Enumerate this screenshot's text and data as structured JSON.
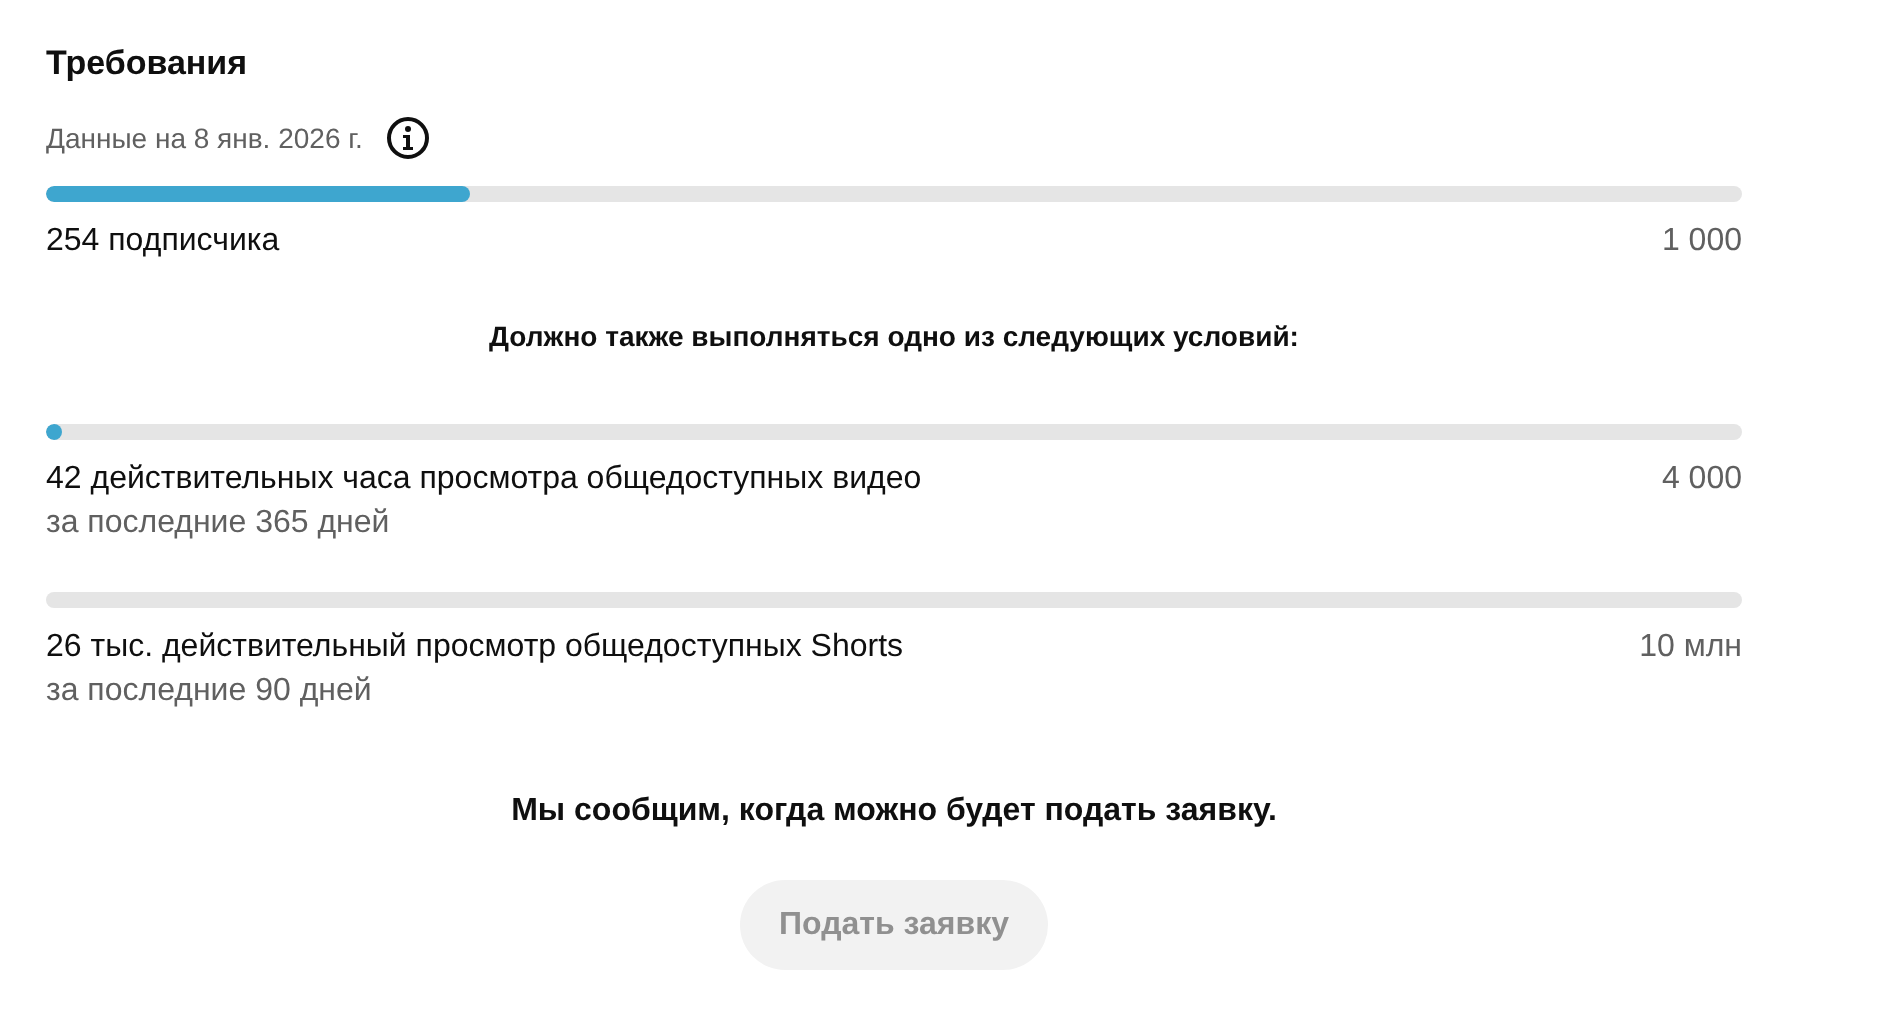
{
  "title": "Требования",
  "data_date": "Данные на 8 янв. 2026 г.",
  "primary": {
    "level": 0.25,
    "label": "254 подписчика",
    "target": "1 000"
  },
  "conditions_heading": "Должно также выполняться одно из следующих условий:",
  "conditions": [
    {
      "level": 0.01,
      "label": "42 действительных часа просмотра общедоступных видео",
      "period": "за последние 365 дней",
      "target": "4 000"
    },
    {
      "level": 0,
      "label": "26 тыс. действительный просмотр общедоступных Shorts",
      "period": "за последние 90 дней",
      "target": "10 млн"
    }
  ],
  "message": "Мы сообщим, когда можно будет подать заявку.",
  "apply_button": {
    "label": "Подать заявку",
    "disabled": true
  }
}
